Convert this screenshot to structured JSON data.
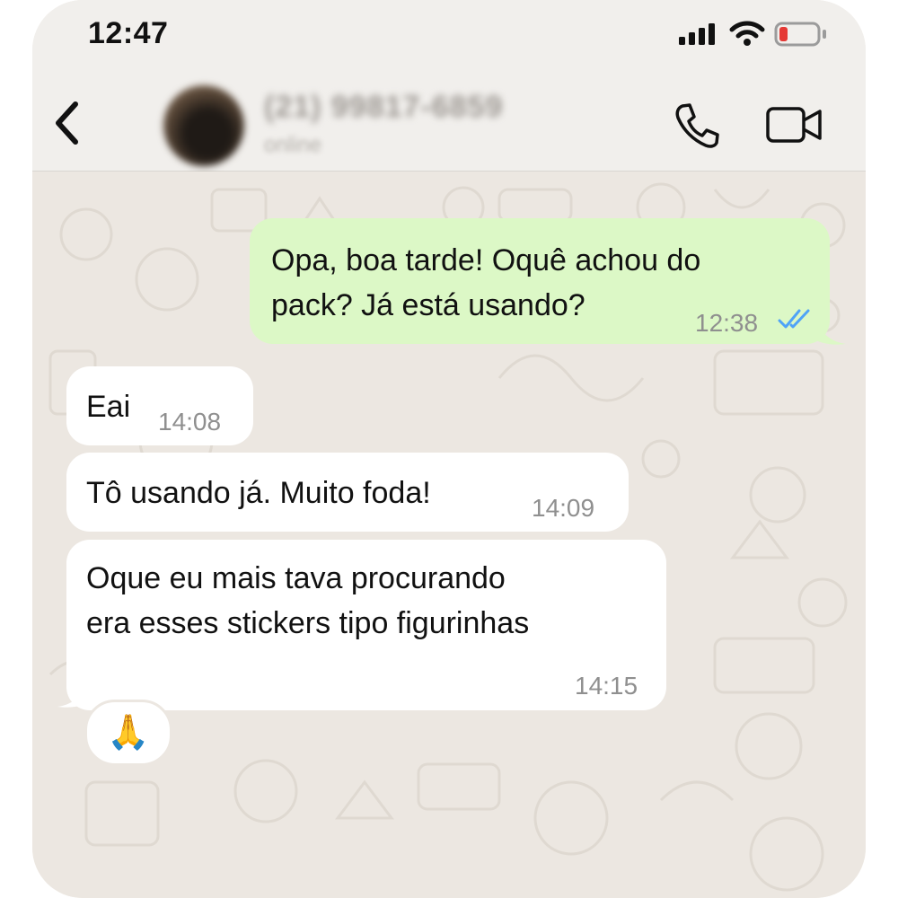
{
  "status_bar": {
    "time": "12:47",
    "icons": [
      "signal-icon",
      "wifi-icon",
      "battery-low-icon"
    ],
    "battery_color": "#e53935"
  },
  "header": {
    "contact_name": "(21) 99817-6859",
    "contact_status": "online",
    "icons": [
      "back-chevron-icon",
      "phone-icon",
      "video-camera-icon"
    ]
  },
  "messages": [
    {
      "direction": "outgoing",
      "text_lines": [
        "Opa, boa tarde! Oquê achou do",
        "pack? Já está usando?"
      ],
      "time": "12:38",
      "read_ticks": true,
      "tick_color": "#4fa3f7"
    },
    {
      "direction": "incoming",
      "text_lines": [
        "Eai"
      ],
      "time": "14:08"
    },
    {
      "direction": "incoming",
      "text_lines": [
        "Tô usando já. Muito foda!"
      ],
      "time": "14:09"
    },
    {
      "direction": "incoming",
      "text_lines": [
        "Oque eu mais tava procurando",
        "era esses stickers tipo figurinhas"
      ],
      "time": "14:15",
      "reaction": "🙏"
    }
  ],
  "colors": {
    "outgoing_bubble": "#dcf8c6",
    "incoming_bubble": "#ffffff",
    "chat_background": "#ece7e1",
    "header_background": "#f1efec"
  }
}
